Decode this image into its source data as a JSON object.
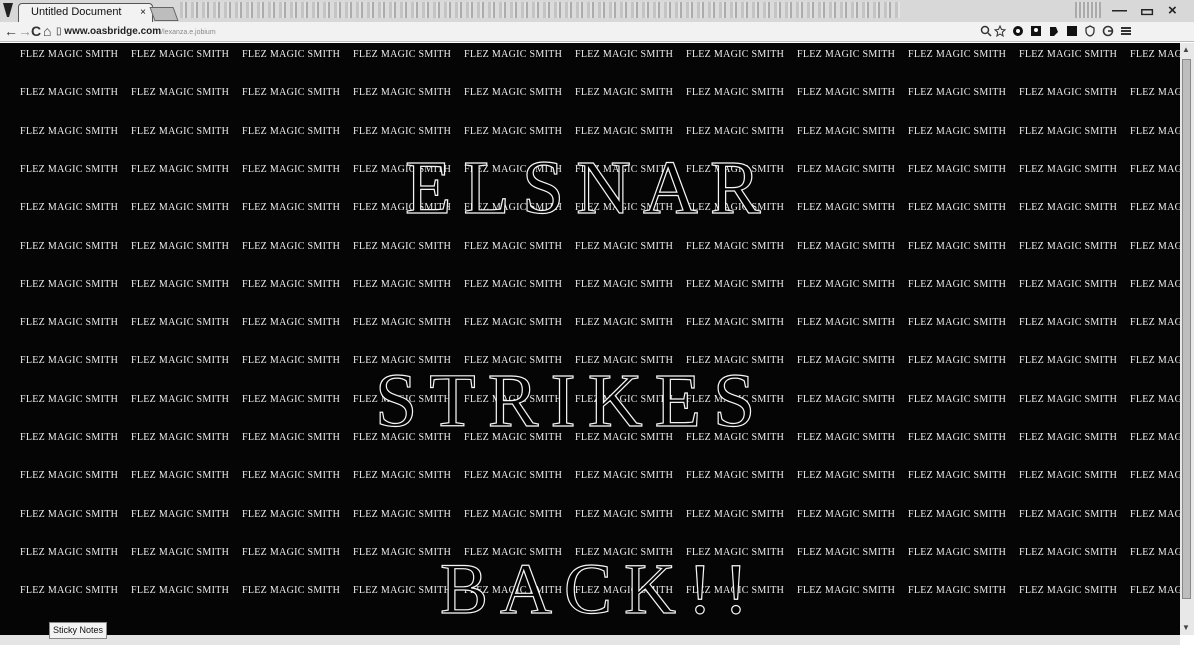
{
  "browser": {
    "tab_title": "Untitled Document",
    "tab_close": "×",
    "url_host": "www.oasbridge.com",
    "url_path": "/lexanza.e.jobium",
    "nav": {
      "back": "←",
      "forward": "→",
      "reload": "C",
      "home": "⌂",
      "page": "▯"
    },
    "window": {
      "minimize": "—",
      "maximize": "▭",
      "close": "×"
    },
    "status_text": "Sticky Notes"
  },
  "page": {
    "background": "#050505",
    "tile_text": "FLEZ MAGIC SMITH",
    "headline": [
      "ELSNAR",
      "STRIKES",
      "BACK!!"
    ]
  }
}
